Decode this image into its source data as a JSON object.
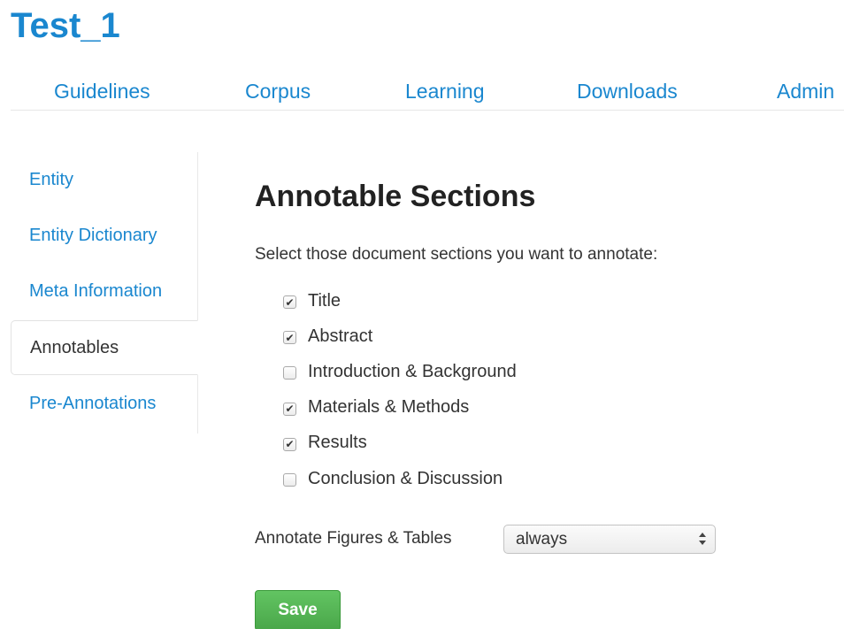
{
  "app": {
    "title": "Test_1"
  },
  "top_nav": {
    "items": [
      {
        "label": "Guidelines"
      },
      {
        "label": "Corpus"
      },
      {
        "label": "Learning"
      },
      {
        "label": "Downloads"
      },
      {
        "label": "Admin"
      }
    ]
  },
  "side_nav": {
    "items": [
      {
        "label": "Entity",
        "active": false
      },
      {
        "label": "Entity Dictionary",
        "active": false
      },
      {
        "label": "Meta Information",
        "active": false
      },
      {
        "label": "Annotables",
        "active": true
      },
      {
        "label": "Pre-Annotations",
        "active": false
      }
    ]
  },
  "main": {
    "heading": "Annotable Sections",
    "instruction": "Select those document sections you want to annotate:",
    "sections": [
      {
        "label": "Title",
        "checked": true
      },
      {
        "label": "Abstract",
        "checked": true
      },
      {
        "label": "Introduction & Background",
        "checked": false
      },
      {
        "label": "Materials & Methods",
        "checked": true
      },
      {
        "label": "Results",
        "checked": true
      },
      {
        "label": "Conclusion & Discussion",
        "checked": false
      }
    ],
    "figures_tables": {
      "label": "Annotate Figures & Tables",
      "selected": "always"
    },
    "save_label": "Save"
  },
  "colors": {
    "link": "#1a87cf",
    "save_button": "#5bb75b"
  },
  "icons": {
    "checkmark": "check-icon",
    "select_arrows": "select-updown-icon"
  }
}
